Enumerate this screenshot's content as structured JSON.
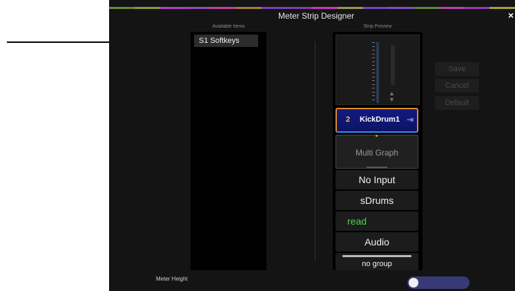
{
  "dialog": {
    "title": "Meter Strip Designer",
    "close_glyph": "×"
  },
  "color_strip": [
    "#6a8a3a",
    "#8a9a3a",
    "#b040c0",
    "#9a4aba",
    "#c040a0",
    "#aa7a3a",
    "#7a40c0",
    "#8a3ab0",
    "#c43ab8",
    "#9a9a4a",
    "#6a4ac8",
    "#8a4ac0",
    "#5a8a3a",
    "#c040b0",
    "#9a3aaa",
    "#a0a040"
  ],
  "available": {
    "header": "Available Items",
    "items": [
      "S1 Softkeys"
    ]
  },
  "preview": {
    "header": "Strip Preview",
    "track_number": "2",
    "track_name": "KickDrum1",
    "track_arrow": "⇥",
    "meter_arrows": "▲\n▼",
    "graph_label": "Multi Graph",
    "input": "No Input",
    "output": "sDrums",
    "automation": "read",
    "type": "Audio",
    "group": "no group"
  },
  "actions": {
    "save": "Save",
    "cancel": "Cancel",
    "default": "Default"
  },
  "footer": {
    "meter_height_label": "Meter Height",
    "meter_height_toggle_on": false
  },
  "colors": {
    "accent_track": "#121a80",
    "automation_read": "#4cd24c",
    "toggle_track": "#383a78"
  }
}
